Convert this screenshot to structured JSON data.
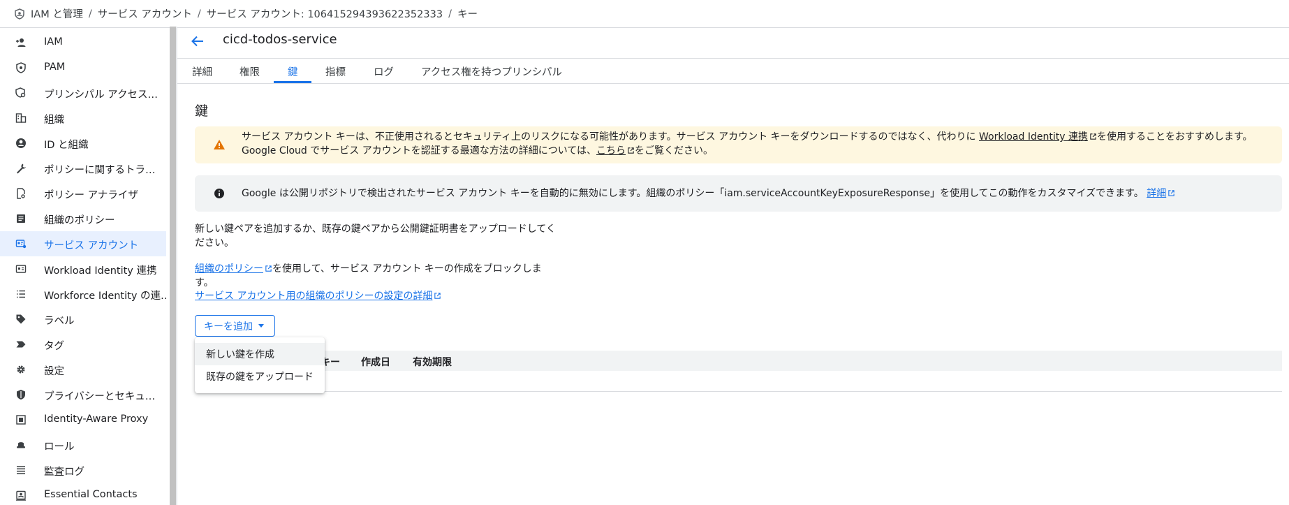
{
  "breadcrumb": {
    "items": [
      "IAM と管理",
      "サービス アカウント",
      "サービス アカウント: 106415294393622352333",
      "キー"
    ],
    "separator": "/"
  },
  "sidebar": {
    "items": [
      {
        "label": "IAM",
        "icon": "person-add-icon"
      },
      {
        "label": "PAM",
        "icon": "shield-icon"
      },
      {
        "label": "プリンシパル アクセス…",
        "icon": "policy-search-icon"
      },
      {
        "label": "組織",
        "icon": "building-icon"
      },
      {
        "label": "ID と組織",
        "icon": "account-circle-icon"
      },
      {
        "label": "ポリシーに関するトラ…",
        "icon": "wrench-icon"
      },
      {
        "label": "ポリシー アナライザ",
        "icon": "doc-search-icon"
      },
      {
        "label": "組織のポリシー",
        "icon": "list-doc-icon"
      },
      {
        "label": "サービス アカウント",
        "icon": "service-account-icon",
        "active": true
      },
      {
        "label": "Workload Identity 連携",
        "icon": "id-card-icon"
      },
      {
        "label": "Workforce Identity の連…",
        "icon": "list-icon"
      },
      {
        "label": "ラベル",
        "icon": "tag-icon"
      },
      {
        "label": "タグ",
        "icon": "label-arrow-icon"
      },
      {
        "label": "設定",
        "icon": "gear-icon"
      },
      {
        "label": "プライバシーとセキュ…",
        "icon": "shield-lock-icon"
      },
      {
        "label": "Identity-Aware Proxy",
        "icon": "proxy-icon"
      },
      {
        "label": "ロール",
        "icon": "hat-icon"
      },
      {
        "label": "監査ログ",
        "icon": "lines-icon"
      },
      {
        "label": "Essential Contacts",
        "icon": "contact-icon"
      }
    ]
  },
  "header": {
    "title": "cicd-todos-service"
  },
  "tabs": [
    {
      "label": "詳細"
    },
    {
      "label": "権限"
    },
    {
      "label": "鍵",
      "active": true
    },
    {
      "label": "指標"
    },
    {
      "label": "ログ"
    },
    {
      "label": "アクセス権を持つプリンシパル"
    }
  ],
  "section_title": "鍵",
  "warning_banner": {
    "text_1": "サービス アカウント キーは、不正使用されるとセキュリティ上のリスクになる可能性があります。サービス アカウント キーをダウンロードするのではなく、代わりに ",
    "link_1": "Workload Identity 連携",
    "text_2": "を使用することをおすすめします。Google Cloud でサービス アカウントを認証する最適な方法の詳細については、",
    "link_2": "こちら",
    "text_3": "をご覧ください。"
  },
  "info_banner": {
    "text": "Google は公開リポジトリで検出されたサービス アカウント キーを自動的に無効にします。組織のポリシー「iam.serviceAccountKeyExposureResponse」を使用してこの動作をカスタマイズできます。",
    "link": "詳細"
  },
  "intro_text": "新しい鍵ペアを追加するか、既存の鍵ペアから公開鍵証明書をアップロードしてください。",
  "org_policy": {
    "link": "組織のポリシー",
    "text": "を使用して、サービス アカウント キーの作成をブロックします。",
    "details_link": "サービス アカウント用の組織のポリシーの設定の詳細"
  },
  "add_key_button": "キーを追加",
  "menu": {
    "items": [
      "新しい鍵を作成",
      "既存の鍵をアップロード"
    ]
  },
  "table": {
    "headers": [
      "キー",
      "作成日",
      "有効期限"
    ]
  },
  "colors": {
    "accent": "#1a73e8",
    "warning_bg": "#fef7e0",
    "warning_icon": "#e37400",
    "info_bg": "#f1f3f4",
    "active_bg": "#e8f0fe"
  }
}
